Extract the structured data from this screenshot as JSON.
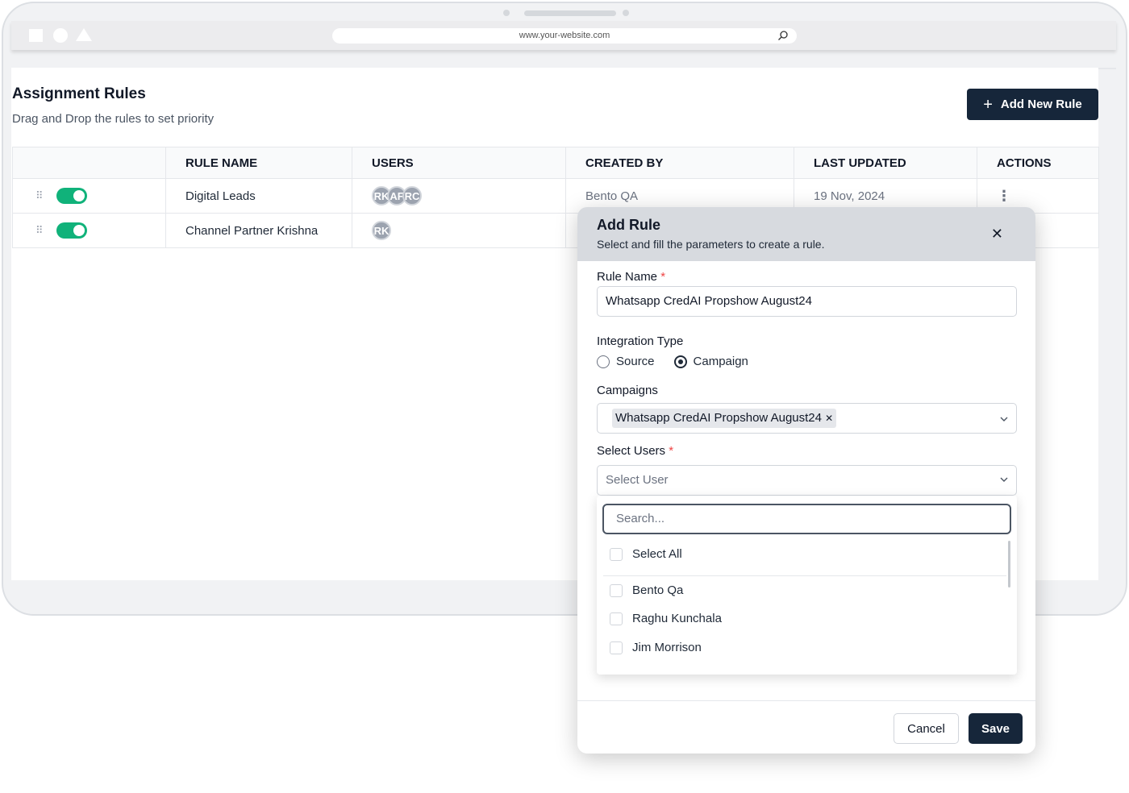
{
  "browser": {
    "url": "www.your-website.com"
  },
  "page": {
    "title": "Assignment Rules",
    "subtitle": "Drag and Drop the rules to set priority",
    "add_button_label": "Add New Rule"
  },
  "table": {
    "headers": [
      "",
      "RULE NAME",
      "USERS",
      "CREATED BY",
      "LAST UPDATED",
      "ACTIONS"
    ],
    "rows": [
      {
        "enabled": true,
        "rule_name": "Digital Leads",
        "users": [
          "RK",
          "AF",
          "RC"
        ],
        "created_by": "Bento QA",
        "last_updated": "19 Nov, 2024"
      },
      {
        "enabled": true,
        "rule_name": "Channel Partner Krishna",
        "users": [
          "RK"
        ],
        "created_by": "",
        "last_updated": ""
      }
    ]
  },
  "modal": {
    "title": "Add Rule",
    "subtitle": "Select and fill the parameters to create a rule.",
    "rule_name_label": "Rule Name",
    "rule_name_value": "Whatsapp CredAI Propshow August24",
    "integration_type_label": "Integration Type",
    "integration_options": [
      "Source",
      "Campaign"
    ],
    "integration_selected": "Campaign",
    "campaigns_label": "Campaigns",
    "campaigns_selected": [
      "Whatsapp CredAI Propshow August24"
    ],
    "select_users_label": "Select Users",
    "select_users_placeholder": "Select User",
    "search_placeholder": "Search...",
    "select_all_label": "Select All",
    "user_options": [
      "Bento Qa",
      "Raghu Kunchala",
      "Jim Morrison"
    ],
    "cancel_label": "Cancel",
    "save_label": "Save"
  },
  "colors": {
    "primary": "#16263a",
    "toggle_on": "#10b27a",
    "required": "#ef4444"
  }
}
